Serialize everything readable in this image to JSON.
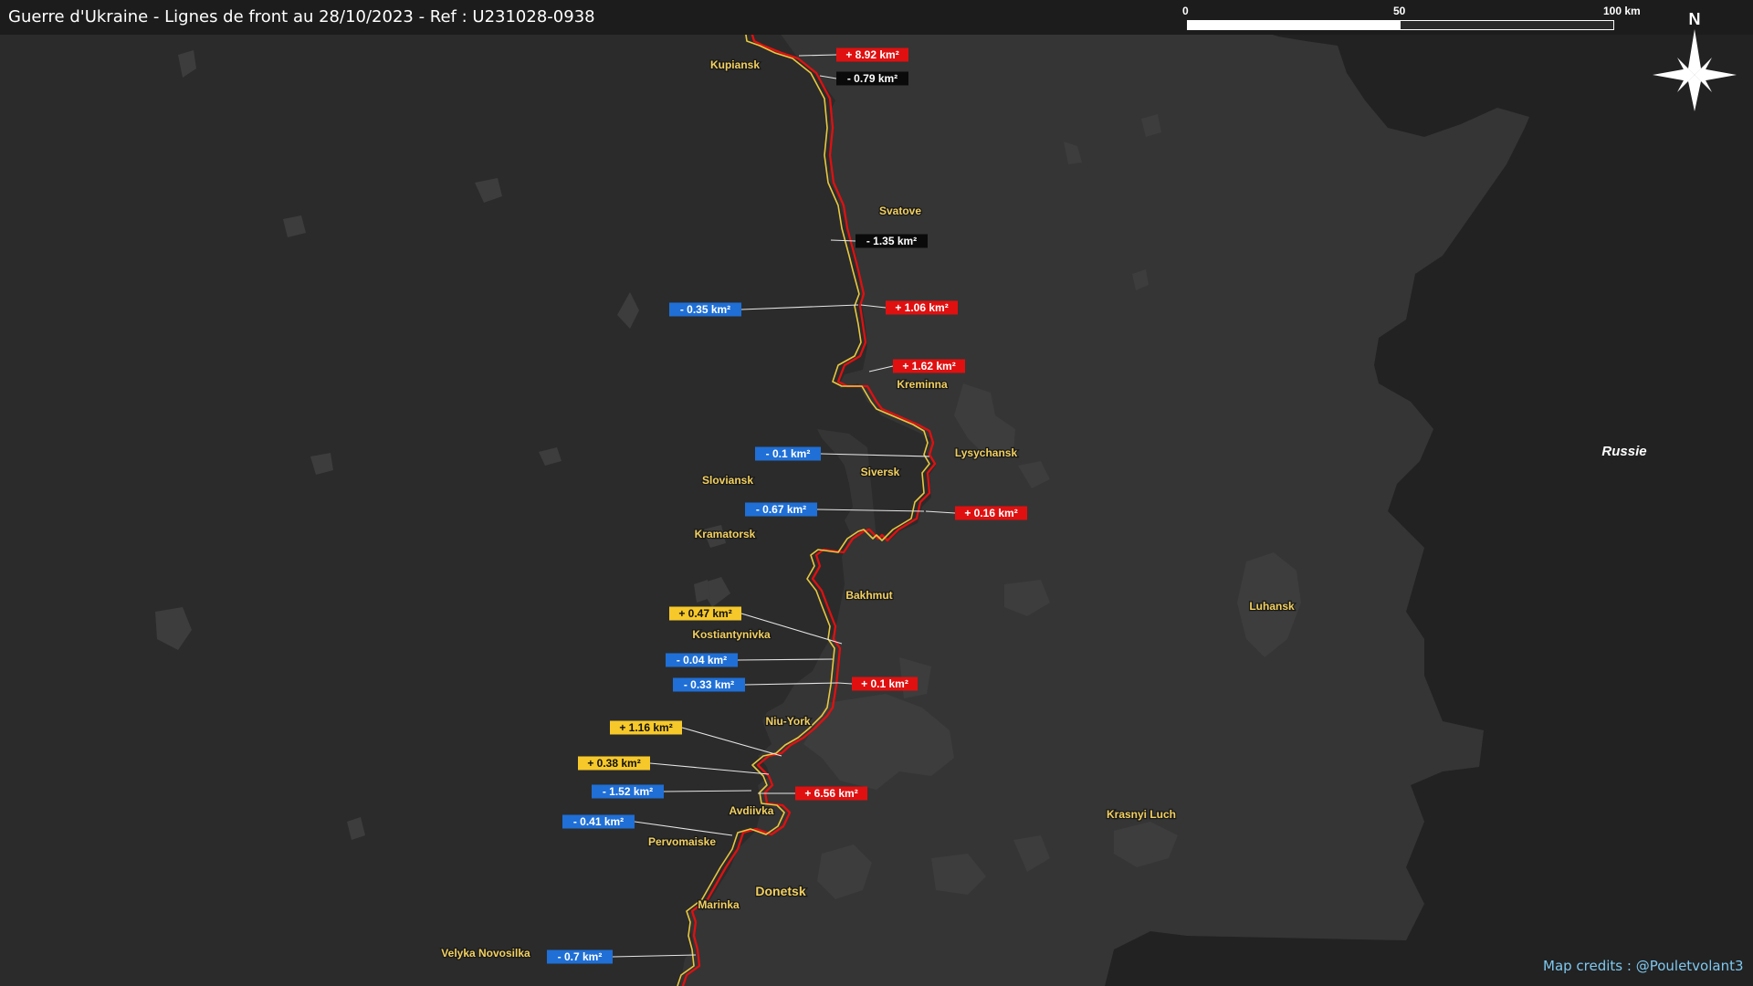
{
  "title": "Guerre d'Ukraine - Lignes de front au 28/10/2023 - Ref : U231028-0938",
  "credits": "Map credits : @Pouletvolant3",
  "scale": {
    "start": "0",
    "mid": "50",
    "end": "100 km"
  },
  "compass": {
    "label": "N",
    "icon": "compass-rose-icon"
  },
  "colors": {
    "background": "#2b2b2b",
    "russia_area": "#222222",
    "ukraine_occupied": "#353535",
    "urban": "#3f3f3f",
    "front_line_previous": "#e01010",
    "front_line_current": "#e8c840",
    "city_label": "#f2d060",
    "tag_gain": "#e01010",
    "tag_loss": "#1f6fd6",
    "tag_yellow": "#f6c82a",
    "tag_black": "#0a0a0a"
  },
  "country_labels": [
    {
      "name": "Russie"
    }
  ],
  "cities": [
    {
      "name": "Kupiansk"
    },
    {
      "name": "Svatove"
    },
    {
      "name": "Kreminna"
    },
    {
      "name": "Lysychansk"
    },
    {
      "name": "Siversk"
    },
    {
      "name": "Sloviansk"
    },
    {
      "name": "Kramatorsk"
    },
    {
      "name": "Bakhmut"
    },
    {
      "name": "Kostiantynivka"
    },
    {
      "name": "Niu-York"
    },
    {
      "name": "Avdiivka"
    },
    {
      "name": "Pervomaiske"
    },
    {
      "name": "Donetsk"
    },
    {
      "name": "Marinka"
    },
    {
      "name": "Velyka Novosilka"
    },
    {
      "name": "Luhansk"
    },
    {
      "name": "Krasnyi Luch"
    }
  ],
  "area_changes": [
    {
      "label": "+ 8.92 km²",
      "type": "gain"
    },
    {
      "label": "- 0.79 km²",
      "type": "black"
    },
    {
      "label": "- 1.35 km²",
      "type": "black"
    },
    {
      "label": "- 0.35 km²",
      "type": "loss"
    },
    {
      "label": "+ 1.06 km²",
      "type": "gain"
    },
    {
      "label": "+ 1.62 km²",
      "type": "gain"
    },
    {
      "label": "- 0.1 km²",
      "type": "loss"
    },
    {
      "label": "- 0.67 km²",
      "type": "loss"
    },
    {
      "label": "+ 0.16 km²",
      "type": "gain"
    },
    {
      "label": "+ 0.47 km²",
      "type": "yellow"
    },
    {
      "label": "- 0.04 km²",
      "type": "loss"
    },
    {
      "label": "- 0.33 km²",
      "type": "loss"
    },
    {
      "label": "+ 0.1 km²",
      "type": "gain"
    },
    {
      "label": "+ 1.16 km²",
      "type": "yellow"
    },
    {
      "label": "+ 0.38 km²",
      "type": "yellow"
    },
    {
      "label": "- 1.52 km²",
      "type": "loss"
    },
    {
      "label": "+ 6.56 km²",
      "type": "gain"
    },
    {
      "label": "- 0.41 km²",
      "type": "loss"
    },
    {
      "label": "- 0.7 km²",
      "type": "loss"
    }
  ]
}
